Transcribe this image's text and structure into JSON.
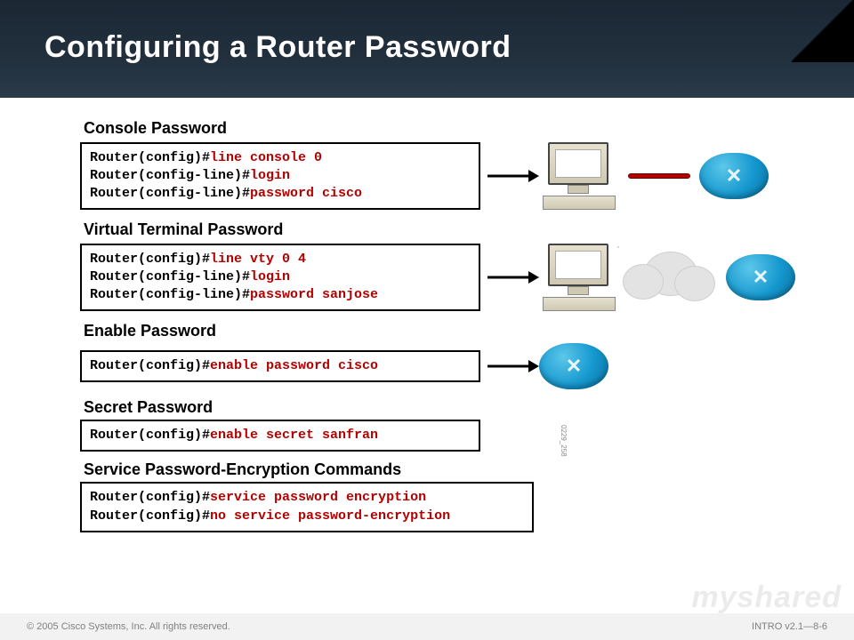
{
  "title": "Configuring a Router Password",
  "footer": {
    "left": "© 2005 Cisco Systems, Inc. All rights reserved.",
    "right": "INTRO v2.1—8-6"
  },
  "watermark": "myshared",
  "sidecode": "0229_258",
  "sections": [
    {
      "label": "Console Password",
      "lines": [
        {
          "prompt": "Router(config)#",
          "cmd": "line console 0"
        },
        {
          "prompt": "Router(config-line)#",
          "cmd": "login"
        },
        {
          "prompt": "Router(config-line)#",
          "cmd": "password cisco"
        }
      ],
      "graphic": "console"
    },
    {
      "label": "Virtual Terminal Password",
      "lines": [
        {
          "prompt": "Router(config)#",
          "cmd": "line vty 0 4"
        },
        {
          "prompt": "Router(config-line)#",
          "cmd": "login"
        },
        {
          "prompt": "Router(config-line)#",
          "cmd": "password sanjose"
        }
      ],
      "graphic": "vty"
    },
    {
      "label": "Enable Password",
      "lines": [
        {
          "prompt": "Router(config)#",
          "cmd": "enable password cisco"
        }
      ],
      "graphic": "router-only"
    },
    {
      "label": "Secret Password",
      "lines": [
        {
          "prompt": "Router(config)#",
          "cmd": "enable secret sanfran"
        }
      ],
      "graphic": "none"
    },
    {
      "label": "Service Password-Encryption Commands",
      "lines": [
        {
          "prompt": "Router(config)#",
          "cmd": "service password encryption"
        },
        {
          "prompt": "Router(config)#",
          "cmd": "no service password-encryption"
        }
      ],
      "graphic": "none"
    }
  ]
}
